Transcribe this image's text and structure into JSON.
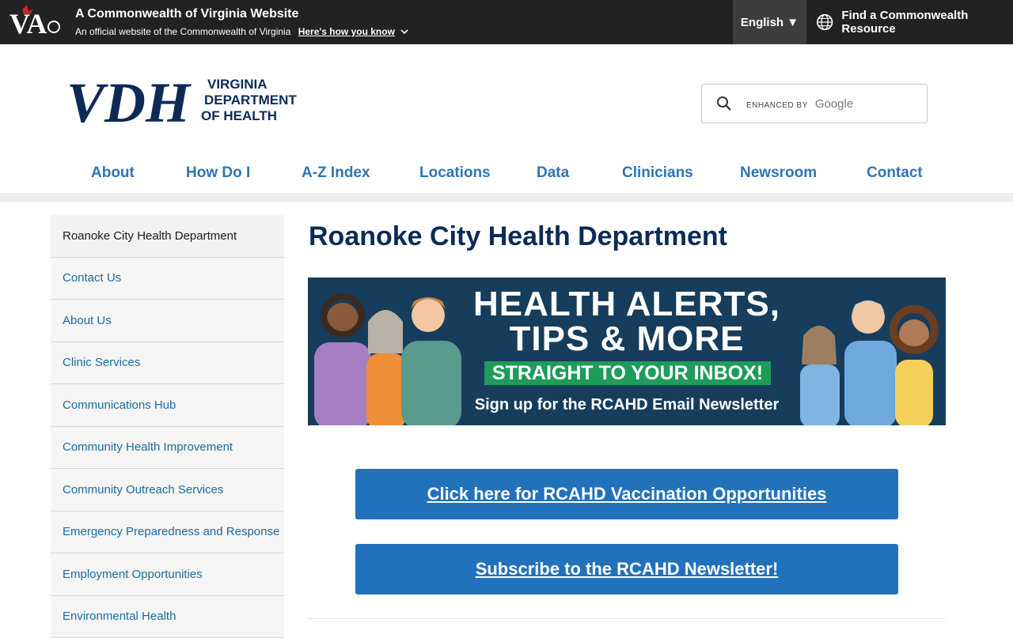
{
  "commonwealth_bar": {
    "title": "A Commonwealth of Virginia Website",
    "subtitle": "An official website of the Commonwealth of Virginia",
    "how_link": "Here's how you know",
    "language": "English ▼",
    "resource_link": "Find a Commonwealth Resource"
  },
  "header": {
    "logo_letters": "VDH",
    "logo_line1": "VIRGINIA",
    "logo_line2": "DEPARTMENT",
    "logo_line3": "OF HEALTH",
    "search_enhanced": "ENHANCED BY",
    "search_google": "Google"
  },
  "nav": {
    "items": [
      {
        "label": "About"
      },
      {
        "label": "How Do I"
      },
      {
        "label": "A-Z Index"
      },
      {
        "label": "Locations"
      },
      {
        "label": "Data"
      },
      {
        "label": "Clinicians"
      },
      {
        "label": "Newsroom"
      },
      {
        "label": "Contact"
      }
    ]
  },
  "sidebar": {
    "items": [
      {
        "label": "Roanoke City Health Department"
      },
      {
        "label": "Contact Us"
      },
      {
        "label": "About Us"
      },
      {
        "label": "Clinic Services"
      },
      {
        "label": "Communications Hub"
      },
      {
        "label": "Community Health Improvement"
      },
      {
        "label": "Community Outreach Services"
      },
      {
        "label": "Emergency Preparedness and Response"
      },
      {
        "label": "Employment Opportunities"
      },
      {
        "label": "Environmental Health"
      }
    ]
  },
  "main": {
    "title": "Roanoke City Health Department",
    "banner": {
      "line1": "HEALTH ALERTS,",
      "line2": "TIPS & MORE",
      "green": "STRAIGHT TO YOUR INBOX!",
      "sub": "Sign up for the RCAHD Email Newsletter"
    },
    "cta_vaccination": "Click here for RCAHD Vaccination Opportunities",
    "cta_newsletter": "Subscribe to the RCAHD Newsletter!"
  },
  "colors": {
    "top_bar": "#222222",
    "nav_link": "#2e75b6",
    "title": "#0d2a57",
    "banner_bg": "#163d5c",
    "banner_green": "#1f9b5a",
    "cta_blue": "#2271bb"
  }
}
